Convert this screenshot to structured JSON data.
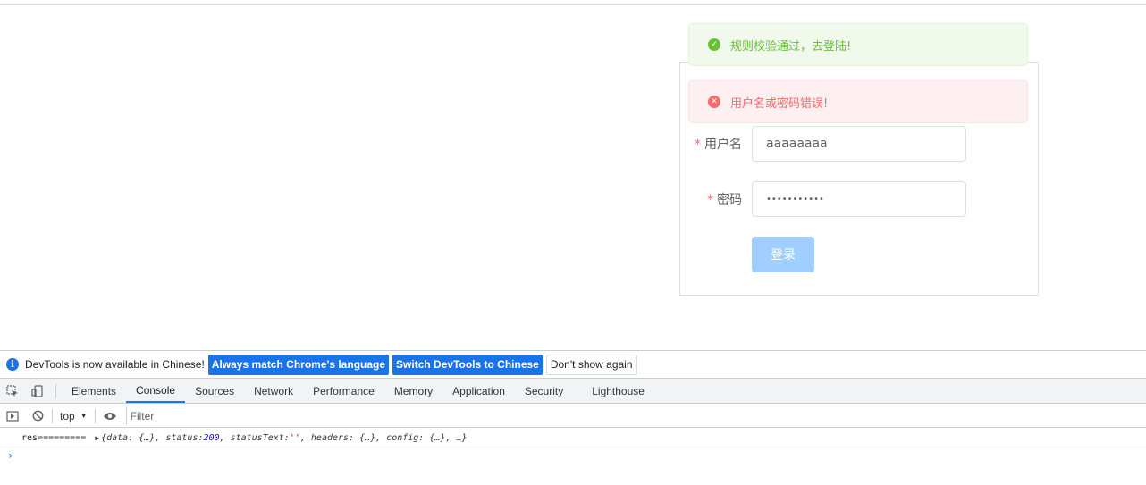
{
  "alerts": {
    "success": "规则校验通过，去登陆!",
    "error": "用户名或密码错误!"
  },
  "form": {
    "username_label": "用户名",
    "username_value": "aaaaaaaa",
    "password_label": "密码",
    "password_value": "•••••••••••",
    "required_mark": "*",
    "login_button": "登录"
  },
  "devtools": {
    "infobar": {
      "message": "DevTools is now available in Chinese!",
      "btn_match": "Always match Chrome's language",
      "btn_switch": "Switch DevTools to Chinese",
      "btn_dismiss": "Don't show again"
    },
    "tabs": [
      "Elements",
      "Console",
      "Sources",
      "Network",
      "Performance",
      "Memory",
      "Application",
      "Security",
      "Lighthouse"
    ],
    "active_tab": "Console",
    "context": "top",
    "filter_placeholder": "Filter",
    "log": {
      "label": "res=========",
      "prefix": "{data: {…}, status: ",
      "status": "200",
      "mid": ", statusText: ",
      "status_text": "''",
      "suffix": ", headers: {…}, config: {…}, …}"
    },
    "prompt": "›"
  },
  "colors": {
    "success": "#67c23a",
    "error": "#f56c6c",
    "primary_disabled": "#a0cfff",
    "devtools_blue": "#1a73e8"
  }
}
